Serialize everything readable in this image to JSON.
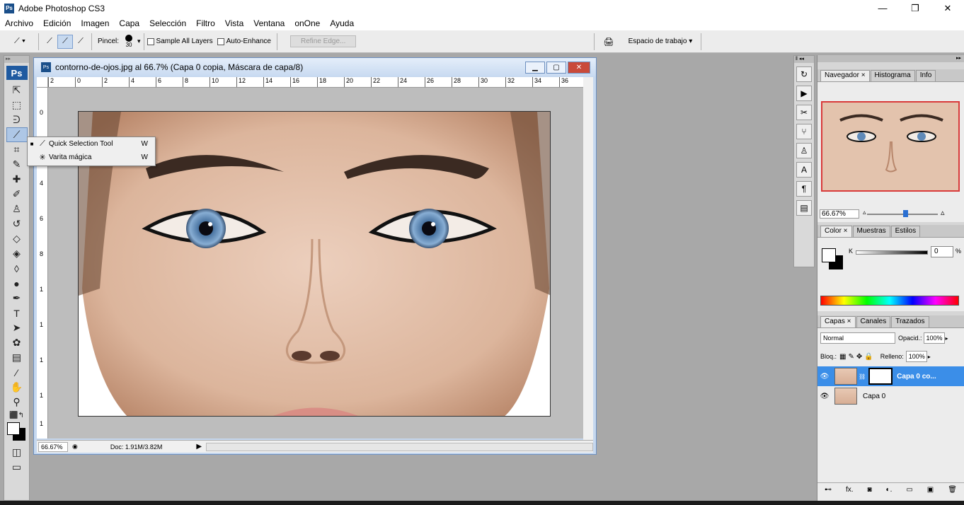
{
  "window": {
    "app_title": "Adobe Photoshop CS3",
    "minimize": "—",
    "maximize": "❐",
    "close": "✕",
    "ps_logo": "Ps"
  },
  "menu": [
    "Archivo",
    "Edición",
    "Imagen",
    "Capa",
    "Selección",
    "Filtro",
    "Vista",
    "Ventana",
    "onOne",
    "Ayuda"
  ],
  "options": {
    "brush_label": "Pincel:",
    "brush_size": "30",
    "sample_all_layers": "Sample All Layers",
    "auto_enhance": "Auto-Enhance",
    "refine_edge": "Refine Edge...",
    "workspace": "Espacio de trabajo"
  },
  "toolbox": {
    "logo": "Ps"
  },
  "document": {
    "title": "contorno-de-ojos.jpg al 66.7% (Capa 0 copia, Máscara de capa/8)",
    "ruler_h": [
      "2",
      "0",
      "2",
      "4",
      "6",
      "8",
      "10",
      "12",
      "14",
      "16",
      "18",
      "20",
      "22",
      "24",
      "26",
      "28",
      "30",
      "32",
      "34",
      "36"
    ],
    "ruler_v": [
      "0",
      "2",
      "4",
      "6",
      "8",
      "1",
      "1",
      "1",
      "1",
      "1"
    ],
    "zoom": "66.67%",
    "doc_size": "Doc: 1.91M/3.82M"
  },
  "flyout": {
    "items": [
      {
        "label": "Quick Selection Tool",
        "key": "W",
        "selected_mark": "■"
      },
      {
        "label": "Varita mágica",
        "key": "W",
        "selected_mark": ""
      }
    ]
  },
  "navigator": {
    "tabs": [
      "Navegador ×",
      "Histograma",
      "Info"
    ],
    "zoom": "66.67%"
  },
  "color": {
    "tabs": [
      "Color ×",
      "Muestras",
      "Estilos"
    ],
    "k_label": "K",
    "k_value": "0",
    "pct": "%"
  },
  "layers": {
    "tabs": [
      "Capas ×",
      "Canales",
      "Trazados"
    ],
    "blend_mode": "Normal",
    "opacity_label": "Opacid.:",
    "opacity": "100%",
    "lock_label": "Bloq.:",
    "fill_label": "Relleno:",
    "fill": "100%",
    "items": [
      {
        "name": "Capa 0 co...",
        "selected": true
      },
      {
        "name": "Capa 0",
        "selected": false
      }
    ],
    "footer": [
      "⊷",
      "fx.",
      "◙",
      "◐.",
      "▭",
      "▣",
      "🗑"
    ]
  },
  "colors": {
    "accent": "#3b8ee8",
    "ps_blue": "#1f5aa0",
    "nav_frame": "#d93a3a"
  }
}
